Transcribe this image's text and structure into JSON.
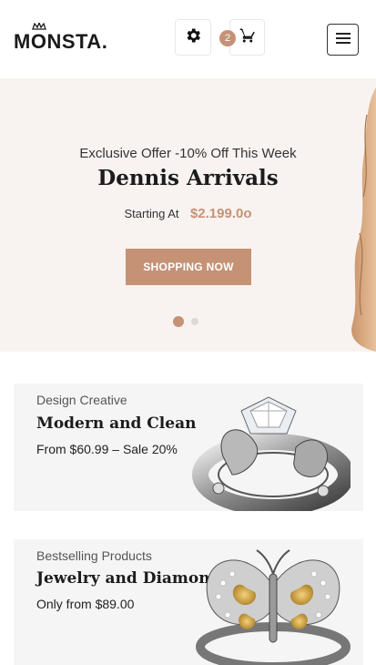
{
  "header": {
    "logo_text": "MONSTA.",
    "settings_icon": "gear-icon",
    "cart_icon": "cart-icon",
    "cart_count": "2",
    "menu_icon": "hamburger-menu-icon"
  },
  "hero": {
    "subtitle": "Exclusive Offer -10% Off This Week",
    "title": "Dennis Arrivals",
    "starting_label": "Starting At",
    "price": "$2.199.0o",
    "cta_label": "SHOPPING NOW",
    "slides_total": 2,
    "active_slide": 1
  },
  "banners": [
    {
      "eyebrow": "Design Creative",
      "title": "Modern and Clean",
      "note": "From $60.99 – Sale 20%",
      "image": "diamond-ring"
    },
    {
      "eyebrow": "Bestselling Products",
      "title": "Jewelry and Diamonds",
      "note": "Only from $89.00",
      "image": "butterfly-ring"
    }
  ],
  "colors": {
    "accent": "#c59275",
    "hero_bg": "#f8f3f1",
    "banner_bg": "#f5f5f5"
  }
}
